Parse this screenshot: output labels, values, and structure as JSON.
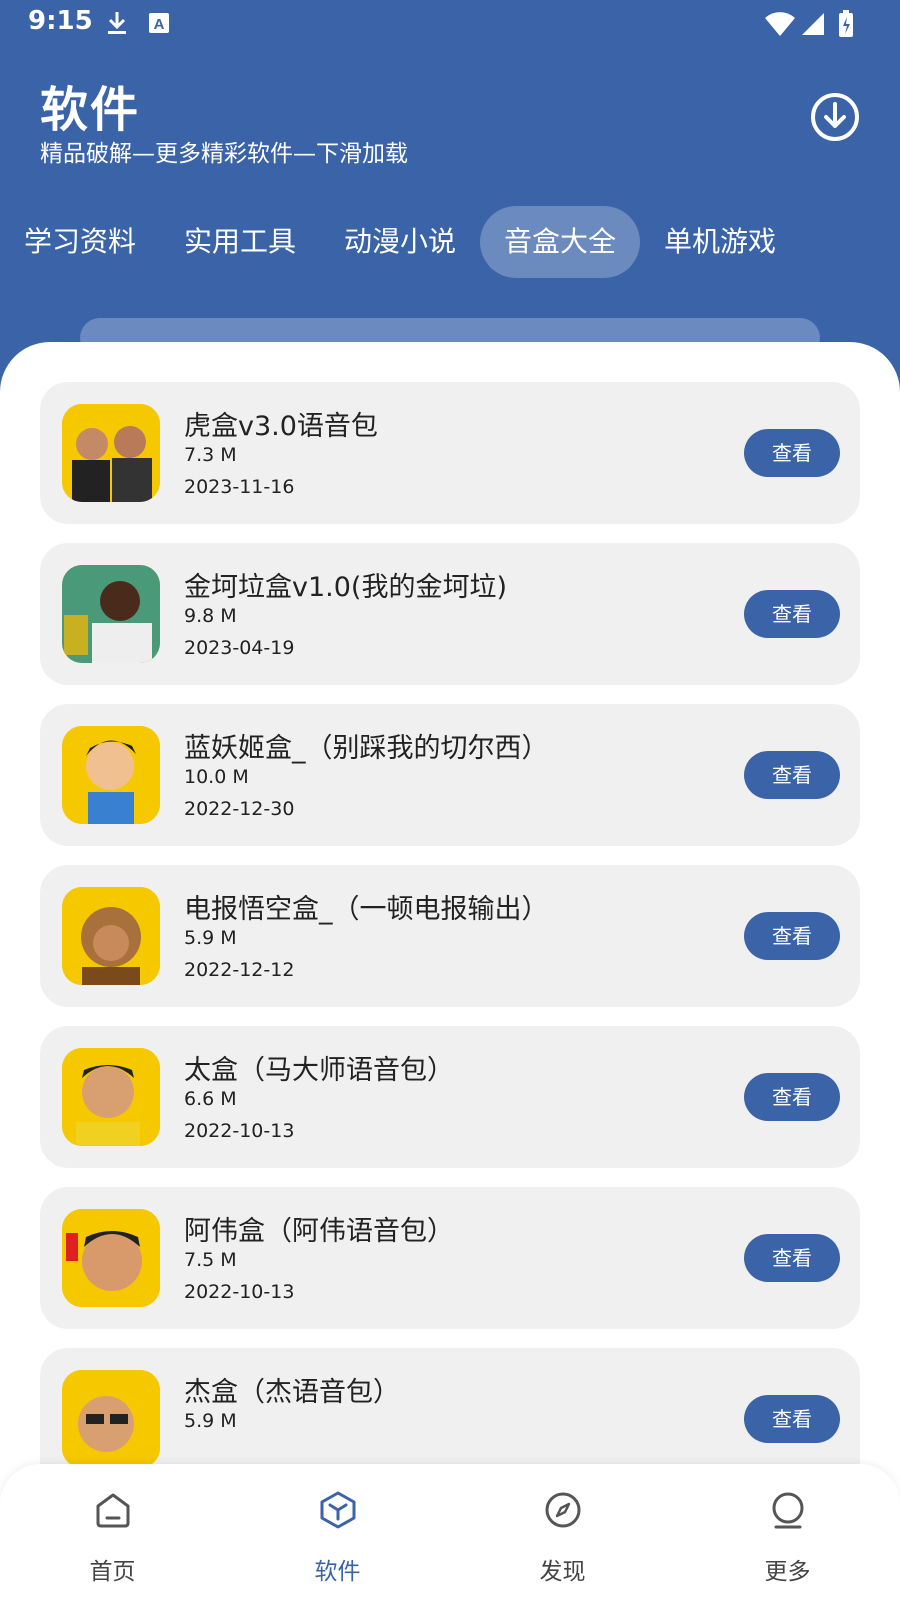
{
  "status_bar": {
    "time": "9:15"
  },
  "header": {
    "title": "软件",
    "subtitle": "精品破解—更多精彩软件—下滑加载"
  },
  "tabs": [
    {
      "label": "学习资料",
      "active": false
    },
    {
      "label": "实用工具",
      "active": false
    },
    {
      "label": "动漫小说",
      "active": false
    },
    {
      "label": "音盒大全",
      "active": true
    },
    {
      "label": "单机游戏",
      "active": false
    }
  ],
  "items": [
    {
      "name": "虎盒v3.0语音包",
      "size": "7.3 M",
      "date": "2023-11-16",
      "button": "查看",
      "icon": "app-icon"
    },
    {
      "name": "金坷垃盒v1.0(我的金坷垃)",
      "size": "9.8 M",
      "date": "2023-04-19",
      "button": "查看",
      "icon": "app-icon"
    },
    {
      "name": "蓝妖姬盒_（别踩我的切尔西）",
      "size": "10.0 M",
      "date": "2022-12-30",
      "button": "查看",
      "icon": "app-icon"
    },
    {
      "name": "电报悟空盒_（一顿电报输出）",
      "size": "5.9 M",
      "date": "2022-12-12",
      "button": "查看",
      "icon": "app-icon"
    },
    {
      "name": "太盒（马大师语音包）",
      "size": "6.6 M",
      "date": "2022-10-13",
      "button": "查看",
      "icon": "app-icon"
    },
    {
      "name": "阿伟盒（阿伟语音包）",
      "size": "7.5 M",
      "date": "2022-10-13",
      "button": "查看",
      "icon": "app-icon"
    },
    {
      "name": "杰盒（杰语音包）",
      "size": "5.9 M",
      "date": "",
      "button": "查看",
      "icon": "app-icon"
    }
  ],
  "bottom_nav": [
    {
      "label": "首页",
      "icon": "home-icon",
      "active": false
    },
    {
      "label": "软件",
      "icon": "cube-icon",
      "active": true
    },
    {
      "label": "发现",
      "icon": "compass-icon",
      "active": false
    },
    {
      "label": "更多",
      "icon": "person-icon",
      "active": false
    }
  ],
  "colors": {
    "primary": "#3a63a8",
    "card_bg": "#f0f0f0",
    "icon_bg": "#f5c800"
  }
}
